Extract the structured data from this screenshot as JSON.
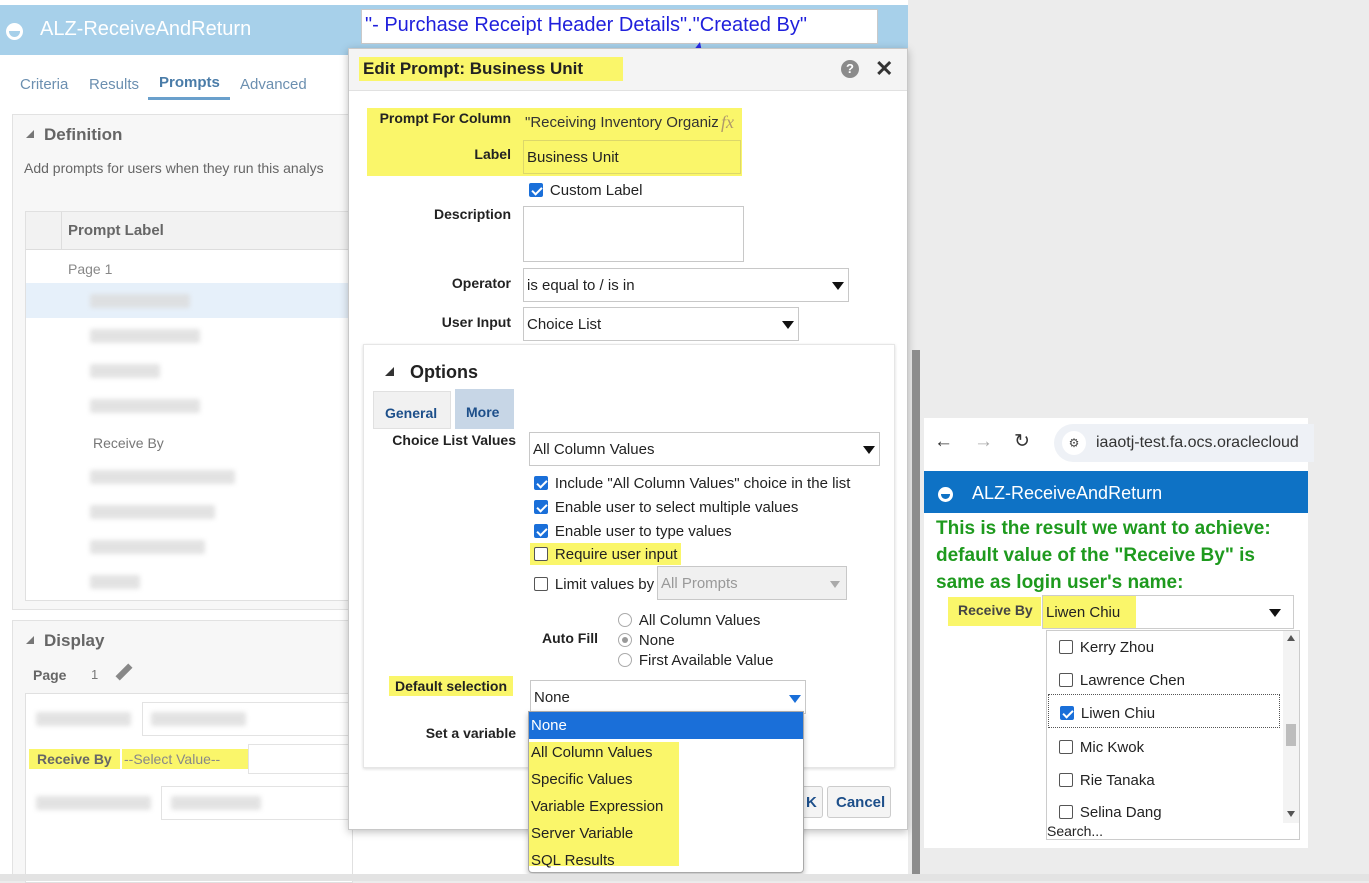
{
  "app": {
    "title": "ALZ-ReceiveAndReturn",
    "tabs": [
      "Criteria",
      "Results",
      "Prompts",
      "Advanced"
    ],
    "definition": {
      "header": "Definition",
      "desc": "Add prompts for users when they run this analys",
      "col_header": "Prompt Label",
      "page_label": "Page 1",
      "receive_by": "Receive By"
    },
    "display": {
      "header": "Display",
      "page_label": "Page",
      "page_num": "1",
      "receive_by_label": "Receive By",
      "receive_by_value": "--Select Value--"
    }
  },
  "annotation": {
    "callout": "\"- Purchase Receipt Header Details\".\"Created By\""
  },
  "dialog": {
    "title": "Edit Prompt: Business Unit",
    "help_icon": "help-icon",
    "close_icon": "close-icon",
    "prompt_for_column_label": "Prompt For Column",
    "prompt_for_column_value": "\"Receiving Inventory Organiz",
    "fx": "fx",
    "label_label": "Label",
    "label_value": "Business Unit",
    "custom_label": "Custom Label",
    "description_label": "Description",
    "operator_label": "Operator",
    "operator_value": "is equal to / is in",
    "user_input_label": "User Input",
    "user_input_value": "Choice List",
    "options_header": "Options",
    "tab_general": "General",
    "tab_more": "More",
    "choice_list_label": "Choice List Values",
    "choice_list_value": "All Column Values",
    "opt_include_all": "Include \"All Column Values\" choice in the list",
    "opt_multiple": "Enable user to select multiple values",
    "opt_type": "Enable user to type values",
    "opt_require": "Require user input",
    "opt_limit": "Limit values by",
    "limit_value": "All Prompts",
    "auto_fill_label": "Auto Fill",
    "auto_fill_options": [
      "All Column Values",
      "None",
      "First Available Value"
    ],
    "default_selection_label": "Default selection",
    "default_selection_value": "None",
    "set_variable_label": "Set a variable",
    "default_options": [
      "None",
      "All Column Values",
      "Specific Values",
      "Variable Expression",
      "Server Variable",
      "SQL Results"
    ],
    "ok_button": "OK",
    "ok_visible": "K",
    "cancel_button": "Cancel"
  },
  "browser": {
    "url": "iaaotj-test.fa.ocs.oraclecloud",
    "app_title": "ALZ-ReceiveAndReturn",
    "note": " This is the result we want to achieve: default value of the \"Receive By\" is same as login user's name:",
    "receive_by_label": "Receive By",
    "receive_by_value": "Liwen Chiu",
    "list": [
      {
        "name": "Kerry Zhou",
        "checked": false
      },
      {
        "name": "Lawrence Chen",
        "checked": false
      },
      {
        "name": "Liwen Chiu",
        "checked": true
      },
      {
        "name": "Mic Kwok",
        "checked": false
      },
      {
        "name": "Rie Tanaka",
        "checked": false
      },
      {
        "name": "Selina Dang",
        "checked": false
      }
    ],
    "search": "Search..."
  },
  "colors": {
    "highlight": "#faf66a",
    "header_blue": "#a7d0ea",
    "browser_blue": "#0e72c5",
    "note_green": "#1e9a1e",
    "callout_blue": "#1f1fdc",
    "select_blue": "#1a6fd9"
  }
}
